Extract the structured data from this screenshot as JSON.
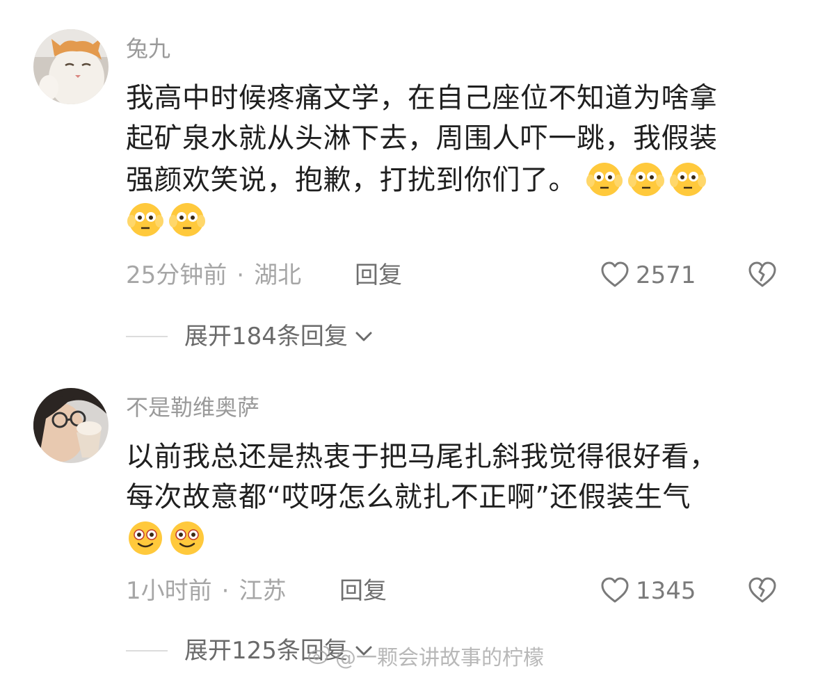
{
  "comments": [
    {
      "username": "兔九",
      "avatar": "cat-avatar",
      "lines": [
        "我高中时候疼痛文学，在自己座位不知道为啥拿",
        "起矿泉水就从头淋下去，周围人吓一跳，我假装",
        "强颜欢笑说，抱歉，打扰到你们了。"
      ],
      "emoji_icon": "flushed-emoji-icon",
      "emoji_count_inline": 3,
      "emoji_count_next_line": 2,
      "time": "25分钟前",
      "dot": "·",
      "location": "湖北",
      "reply_label": "回复",
      "like_count": "2571",
      "expand_label": "展开184条回复"
    },
    {
      "username": "不是勒维奥萨",
      "avatar": "person-avatar",
      "lines": [
        "以前我总还是热衷于把马尾扎斜我觉得很好看，",
        "每次故意都“哎呀怎么就扎不正啊”还假装生气"
      ],
      "emoji_icon": "smile-emoji-icon",
      "emoji_count_inline": 0,
      "emoji_count_next_line": 2,
      "time": "1小时前",
      "dot": "·",
      "location": "江苏",
      "reply_label": "回复",
      "like_count": "1345",
      "expand_label": "展开125条回复"
    }
  ],
  "watermark": "@一颗会讲故事的柠檬",
  "colors": {
    "meta_gray": "#a6a6a6",
    "emoji_yellow": "#ffc93c"
  }
}
